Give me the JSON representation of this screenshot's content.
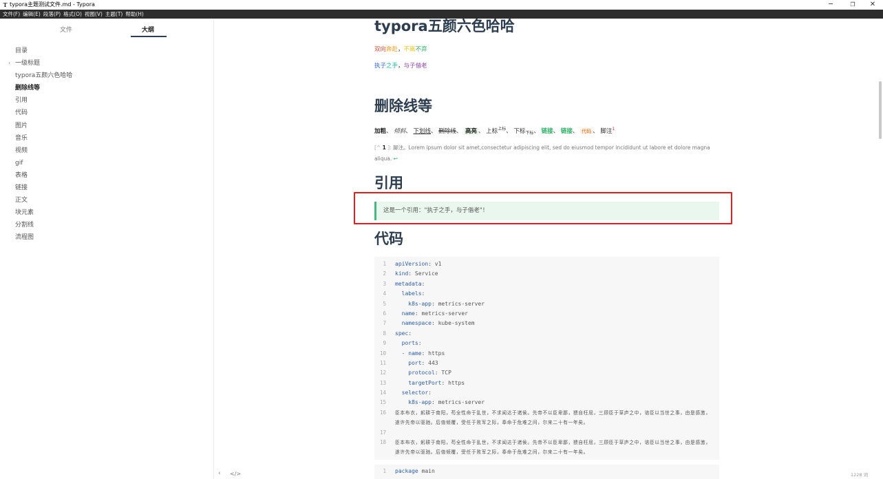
{
  "window": {
    "app_icon": "T",
    "title": "typora主题测试文件.md - Typora",
    "minimize_icon": "minimize-icon",
    "maximize_icon": "restore-icon",
    "close_icon": "close-icon"
  },
  "menubar": {
    "items": [
      "文件(F)",
      "编辑(E)",
      "段落(P)",
      "格式(O)",
      "视图(V)",
      "主题(T)",
      "帮助(H)"
    ]
  },
  "sidebar": {
    "tabs": [
      "文件",
      "大纲"
    ],
    "active_tab": "大纲",
    "outline": [
      {
        "label": "目录",
        "caret": ""
      },
      {
        "label": "一级标题",
        "caret": "›"
      },
      {
        "label": "typora五颜六色哈哈",
        "caret": ""
      },
      {
        "label": "删除线等",
        "caret": "",
        "active": true
      },
      {
        "label": "引用",
        "caret": ""
      },
      {
        "label": "代码",
        "caret": ""
      },
      {
        "label": "图片",
        "caret": ""
      },
      {
        "label": "音乐",
        "caret": ""
      },
      {
        "label": "视频",
        "caret": ""
      },
      {
        "label": "gif",
        "caret": ""
      },
      {
        "label": "表格",
        "caret": ""
      },
      {
        "label": "链接",
        "caret": ""
      },
      {
        "label": "正文",
        "caret": ""
      },
      {
        "label": "块元素",
        "caret": ""
      },
      {
        "label": "分割线",
        "caret": ""
      },
      {
        "label": "流程图",
        "caret": ""
      }
    ],
    "footer": {
      "collapse": "‹",
      "source": "</>"
    }
  },
  "doc": {
    "h_colors": "typora五颜六色哈哈",
    "line1": {
      "a": "双向",
      "b": "奔赴",
      "sep": "，",
      "c": "不离",
      "d": "不弃"
    },
    "line2": {
      "a": "执子",
      "b": "之手",
      "sep": "，",
      "c": "与子偕老"
    },
    "h_strike": "删除线等",
    "inline": {
      "bold": "加粗",
      "sep": "、",
      "italic": "倾斜",
      "underline": "下划线",
      "strike": "删除线",
      "highlight": "高亮",
      "sup_base": "上标",
      "sup": "上标",
      "sub_base": "下标",
      "sub": "下标",
      "link1": "链接",
      "link2": "链接",
      "code": "代码",
      "footnote": "脚注",
      "fnref": "1"
    },
    "footnote": {
      "label_open": "[^",
      "num": "1",
      "label_close": "]:",
      "text": "脚注。Lorem ipsum dolor sit amet,consectetur adipiscing elit, sed do eiusmod tempor incididunt ut labore et dolore magna",
      "text2": "aliqua.",
      "back": "↩"
    },
    "h_quote": "引用",
    "quote": "这是一个引用：\"执子之手，与子偕老\"！",
    "h_code": "代码",
    "code_lines": [
      {
        "n": "1",
        "key": "apiVersion",
        "val": ": v1",
        "indent": ""
      },
      {
        "n": "2",
        "key": "kind",
        "val": ": Service",
        "indent": ""
      },
      {
        "n": "3",
        "key": "metadata",
        "val": ":",
        "indent": ""
      },
      {
        "n": "4",
        "key": "labels",
        "val": ":",
        "indent": "  "
      },
      {
        "n": "5",
        "key": "k8s-app",
        "val": ": metrics-server",
        "indent": "    "
      },
      {
        "n": "6",
        "key": "name",
        "val": ": metrics-server",
        "indent": "  "
      },
      {
        "n": "7",
        "key": "namespace",
        "val": ": kube-system",
        "indent": "  "
      },
      {
        "n": "8",
        "key": "spec",
        "val": ":",
        "indent": ""
      },
      {
        "n": "9",
        "key": "ports",
        "val": ":",
        "indent": "  "
      },
      {
        "n": "10",
        "key": "- name",
        "val": ": https",
        "indent": "  "
      },
      {
        "n": "11",
        "key": "port",
        "val": ": 443",
        "indent": "    "
      },
      {
        "n": "12",
        "key": "protocol",
        "val": ": TCP",
        "indent": "    "
      },
      {
        "n": "13",
        "key": "targetPort",
        "val": ": https",
        "indent": "    "
      },
      {
        "n": "14",
        "key": "selector",
        "val": ":",
        "indent": "  "
      },
      {
        "n": "15",
        "key": "k8s-app",
        "val": ": metrics-server",
        "indent": "    "
      }
    ],
    "code_prose_16": "臣本布衣，躬耕于南阳，苟全性命于乱世，不求闻达于诸侯。先帝不以臣卑鄙，猥自枉屈，三顾臣于草庐之中，谘臣以当世之事，由是感激，遂许先帝以驱驰。后值倾覆，受任于败军之际，奉命于危难之间，尔来二十有一年矣。",
    "code_n16": "16",
    "code_n17": "17",
    "code_n18": "18",
    "code_prose_18": "臣本布衣，躬耕于南阳，苟全性命于乱世，不求闻达于诸侯。先帝不以臣卑鄙，猥自枉屈，三顾臣于草庐之中，谘臣以当世之事，由是感激，遂许先帝以驱驰。后值倾覆，受任于败军之际，奉命于危难之间，尔来二十有一年矣。",
    "code2_n": "1",
    "code2_kw": "package",
    "code2_rest": " main"
  },
  "status": {
    "word_count": "1228 词"
  },
  "colors": {
    "accent": "#42b983",
    "heading": "#2c3e50",
    "highlight_box": "#e02020",
    "menubar": "#2d2d2d"
  }
}
